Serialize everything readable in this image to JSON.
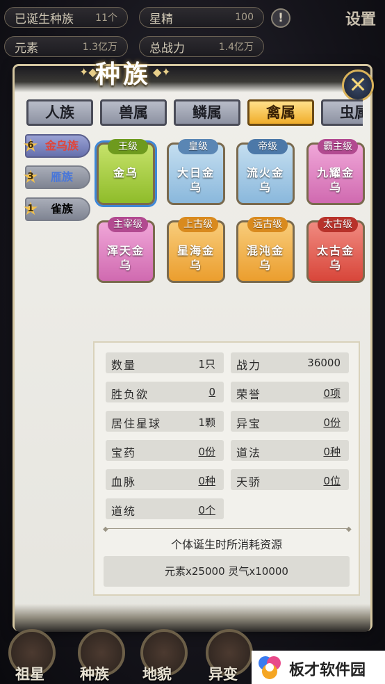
{
  "hud": {
    "born_species_label": "已诞生种族",
    "born_species_value": "11个",
    "star_essence_label": "星精",
    "star_essence_value": "100",
    "element_label": "元素",
    "element_value": "1.3亿万",
    "combat_label": "总战力",
    "combat_value": "1.4亿万",
    "settings_label": "设置"
  },
  "panel": {
    "title": "种族"
  },
  "tabs": [
    {
      "label": "人族"
    },
    {
      "label": "兽属"
    },
    {
      "label": "鳞属"
    },
    {
      "label": "禽属"
    },
    {
      "label": "虫属"
    }
  ],
  "side_nav": [
    {
      "count": "6",
      "label": "金乌族",
      "color": "#e0453a"
    },
    {
      "count": "3",
      "label": "雁族",
      "color": "#4a77d8"
    },
    {
      "count": "1",
      "label": "雀族",
      "color": "#1e1f26"
    }
  ],
  "cards": [
    {
      "rank": "王级",
      "name": "金乌",
      "color": "#a9cc3a",
      "rank_color": "#6e9a1e"
    },
    {
      "rank": "皇级",
      "name": "大日金乌",
      "color": "#9ec8e6",
      "rank_color": "#5a86b4"
    },
    {
      "rank": "帝级",
      "name": "流火金乌",
      "color": "#9ec8e6",
      "rank_color": "#4c78a8"
    },
    {
      "rank": "霸主级",
      "name": "九耀金乌",
      "color": "#de7bc0",
      "rank_color": "#b24a90"
    },
    {
      "rank": "主宰级",
      "name": "浑天金乌",
      "color": "#de7bc0",
      "rank_color": "#b24a90"
    },
    {
      "rank": "上古级",
      "name": "星海金乌",
      "color": "#f3b24a",
      "rank_color": "#d98a1e"
    },
    {
      "rank": "远古级",
      "name": "混沌金乌",
      "color": "#f3b24a",
      "rank_color": "#d98a1e"
    },
    {
      "rank": "太古级",
      "name": "太古金乌",
      "color": "#e55a4e",
      "rank_color": "#b8322a"
    }
  ],
  "stats": [
    {
      "label": "数量",
      "value": "1只",
      "underline": false
    },
    {
      "label": "战力",
      "value": "36000",
      "underline": false
    },
    {
      "label": "胜负欲",
      "value": "0",
      "underline": true
    },
    {
      "label": "荣誉",
      "value": "0项",
      "underline": true
    },
    {
      "label": "居住星球",
      "value": "1颗",
      "underline": false
    },
    {
      "label": "异宝",
      "value": "0份",
      "underline": true
    },
    {
      "label": "宝药",
      "value": "0份",
      "underline": true
    },
    {
      "label": "道法",
      "value": "0种",
      "underline": true
    },
    {
      "label": "血脉",
      "value": "0种",
      "underline": true
    },
    {
      "label": "天骄",
      "value": "0位",
      "underline": true
    },
    {
      "label": "道统",
      "value": "0个",
      "underline": true
    }
  ],
  "cost": {
    "title": "个体诞生时所消耗资源",
    "detail": "元素x25000  灵气x10000"
  },
  "bottom_nav": [
    {
      "label": "祖星"
    },
    {
      "label": "种族"
    },
    {
      "label": "地貌"
    },
    {
      "label": "异变"
    }
  ],
  "watermark": {
    "text": "板才软件园"
  }
}
